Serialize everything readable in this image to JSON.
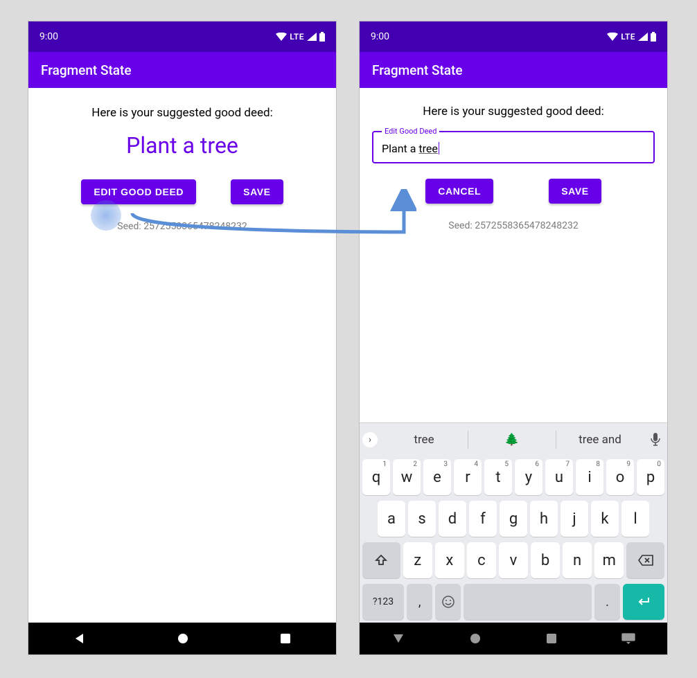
{
  "status": {
    "time": "9:00",
    "network": "LTE"
  },
  "appbar": {
    "title": "Fragment State"
  },
  "screen1": {
    "suggest_label": "Here is your suggested good deed:",
    "deed": "Plant a tree",
    "edit_button": "EDIT GOOD DEED",
    "save_button": "SAVE",
    "seed": "Seed: 2572558365478248232"
  },
  "screen2": {
    "suggest_label": "Here is your suggested good deed:",
    "field_label": "Edit Good Deed",
    "field_value_prefix": "Plant a ",
    "field_value_underlined": "tree",
    "cancel_button": "CANCEL",
    "save_button": "SAVE",
    "seed": "Seed: 2572558365478248232"
  },
  "keyboard": {
    "suggestions": {
      "left": "tree",
      "center_emoji": "🌲",
      "right": "tree and"
    },
    "numbers": [
      "1",
      "2",
      "3",
      "4",
      "5",
      "6",
      "7",
      "8",
      "9",
      "0"
    ],
    "row1": [
      "q",
      "w",
      "e",
      "r",
      "t",
      "y",
      "u",
      "i",
      "o",
      "p"
    ],
    "row2": [
      "a",
      "s",
      "d",
      "f",
      "g",
      "h",
      "j",
      "k",
      "l"
    ],
    "row3": [
      "z",
      "x",
      "c",
      "v",
      "b",
      "n",
      "m"
    ],
    "symbols_key": "?123",
    "comma": ",",
    "period": "."
  }
}
